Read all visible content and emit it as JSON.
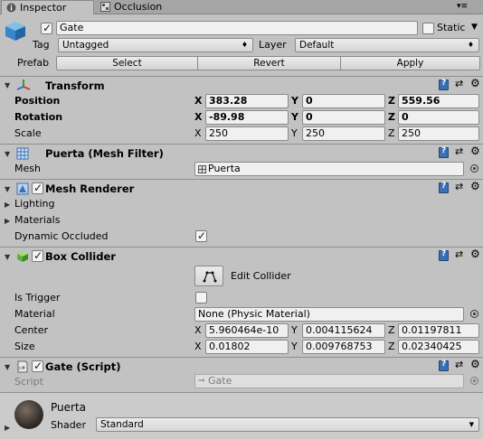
{
  "tabs": [
    {
      "label": "Inspector"
    },
    {
      "label": "Occlusion"
    }
  ],
  "object": {
    "name": "Gate",
    "static_label": "Static",
    "tag_label": "Tag",
    "tag_value": "Untagged",
    "layer_label": "Layer",
    "layer_value": "Default"
  },
  "prefab": {
    "label": "Prefab",
    "select": "Select",
    "revert": "Revert",
    "apply": "Apply"
  },
  "transform": {
    "title": "Transform",
    "position_label": "Position",
    "rotation_label": "Rotation",
    "scale_label": "Scale",
    "position": {
      "x": "383.28",
      "y": "0",
      "z": "559.56"
    },
    "rotation": {
      "x": "-89.98",
      "y": "0",
      "z": "0"
    },
    "scale": {
      "x": "250",
      "y": "250",
      "z": "250"
    }
  },
  "axes": {
    "x": "X",
    "y": "Y",
    "z": "Z"
  },
  "mesh_filter": {
    "title": "Puerta (Mesh Filter)",
    "mesh_label": "Mesh",
    "mesh_value": "Puerta"
  },
  "mesh_renderer": {
    "title": "Mesh Renderer",
    "lighting": "Lighting",
    "materials": "Materials",
    "dynamic_occluded": "Dynamic Occluded"
  },
  "box_collider": {
    "title": "Box Collider",
    "edit_collider": "Edit Collider",
    "is_trigger": "Is Trigger",
    "material_label": "Material",
    "material_value": "None (Physic Material)",
    "center_label": "Center",
    "size_label": "Size",
    "center": {
      "x": "5.960464e-10",
      "y": "0.004115624",
      "z": "0.01197811"
    },
    "size": {
      "x": "0.01802",
      "y": "0.009768753",
      "z": "0.02340425"
    }
  },
  "gate_script": {
    "title": "Gate (Script)",
    "script_label": "Script",
    "script_value": "Gate"
  },
  "material": {
    "name": "Puerta",
    "shader_label": "Shader",
    "shader_value": "Standard"
  },
  "colors": {
    "background": "#c2c2c2",
    "tabbar": "#a5a5a5",
    "field": "#f0f0f0"
  }
}
